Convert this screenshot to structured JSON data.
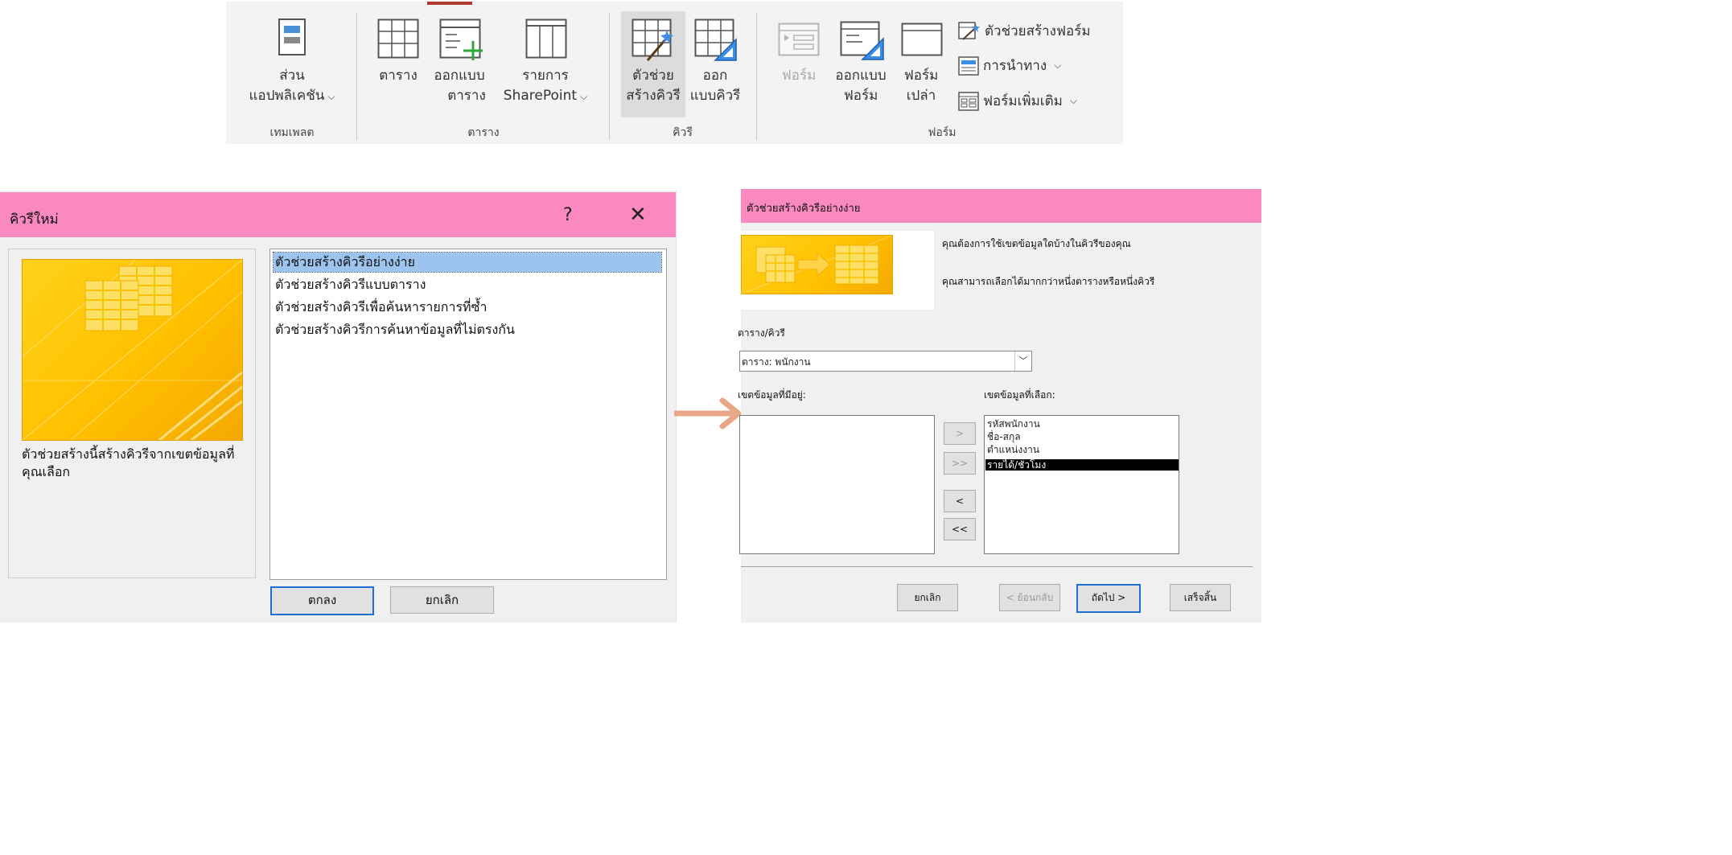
{
  "ribbon": {
    "groups": {
      "templates": "เทมเพลต",
      "tables": "ตาราง",
      "queries": "คิวรี",
      "forms": "ฟอร์ม"
    },
    "buttons": {
      "app_parts": [
        "ส่วน",
        "แอปพลิเคชัน"
      ],
      "table": "ตาราง",
      "table_design": [
        "ออกแบบ",
        "ตาราง"
      ],
      "sharepoint_lists": [
        "รายการ",
        "SharePoint"
      ],
      "query_wizard": [
        "ตัวช่วย",
        "สร้างคิวรี"
      ],
      "query_design": [
        "ออก",
        "แบบคิวรี"
      ],
      "form": "ฟอร์ม",
      "form_design": [
        "ออกแบบ",
        "ฟอร์ม"
      ],
      "blank_form": [
        "ฟอร์ม",
        "เปล่า"
      ],
      "form_wizard": "ตัวช่วยสร้างฟอร์ม",
      "navigation": "การนำทาง",
      "more_forms": "ฟอร์มเพิ่มเติม"
    }
  },
  "new_query_dialog": {
    "title": "คิวรีใหม่",
    "help": "?",
    "close": "✕",
    "description": "ตัวช่วยสร้างนี้สร้างคิวรีจากเขตข้อมูลที่คุณเลือก",
    "wizards": [
      "ตัวช่วยสร้างคิวรีอย่างง่าย",
      "ตัวช่วยสร้างคิวรีแบบตาราง",
      "ตัวช่วยสร้างคิวรีเพื่อค้นหารายการที่ซ้ำ",
      "ตัวช่วยสร้างคิวรีการค้นหาข้อมูลที่ไม่ตรงกัน"
    ],
    "ok": "ตกลง",
    "cancel": "ยกเลิก"
  },
  "simple_wizard": {
    "title": "ตัวช่วยสร้างคิวรีอย่างง่าย",
    "question": "คุณต้องการใช้เขตข้อมูลใดบ้างในคิวรีของคุณ",
    "hint": "คุณสามารถเลือกได้มากกว่าหนึ่งตารางหรือหนึ่งคิวรี",
    "table_query_label": "ตาราง/คิวรี",
    "table_query_value": "ตาราง: พนักงาน",
    "available_label": "เขตข้อมูลที่มีอยู่:",
    "selected_label": "เขตข้อมูลที่เลือก:",
    "selected_fields": [
      "รหัสพนักงาน",
      "ชื่อ-สกุล",
      "ตำแหน่งงาน",
      "รายได้/ชั่วโมง"
    ],
    "move_buttons": [
      ">",
      ">>",
      "<",
      "<<"
    ],
    "cancel": "ยกเลิก",
    "back": "< ย้อนกลับ",
    "next": "ถัดไป >",
    "finish": "เสร็จสิ้น"
  },
  "colors": {
    "title_bar": "#f989c0",
    "arrow": "#e8a888",
    "wizard_art": "#ffc000",
    "selection": "#9dc4ef"
  }
}
